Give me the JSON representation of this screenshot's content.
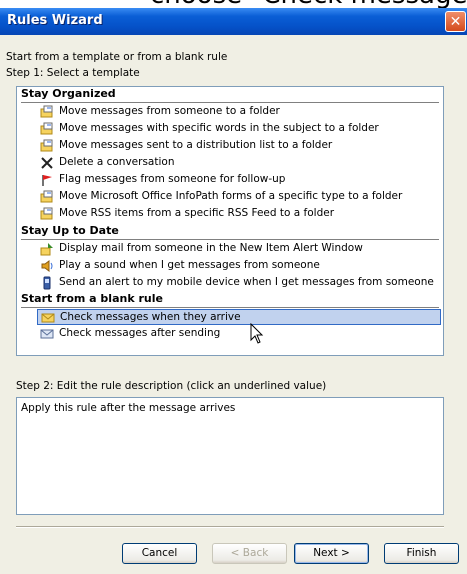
{
  "background_overlay": {
    "text": "choose \"Check messages when"
  },
  "window": {
    "title": "Rules Wizard"
  },
  "intro": {
    "line1": "Start from a template or from a blank rule",
    "line2": "Step 1: Select a template"
  },
  "groups": {
    "stay_organized": {
      "header": "Stay Organized",
      "items": [
        {
          "label": "Move messages from someone to a folder",
          "icon": "move-to-folder-icon"
        },
        {
          "label": "Move messages with specific words in the subject to a folder",
          "icon": "move-to-folder-icon"
        },
        {
          "label": "Move messages sent to a distribution list to a folder",
          "icon": "move-to-folder-icon"
        },
        {
          "label": "Delete a conversation",
          "icon": "delete-x-icon"
        },
        {
          "label": "Flag messages from someone for follow-up",
          "icon": "red-flag-icon"
        },
        {
          "label": "Move Microsoft Office InfoPath forms of a specific type to a folder",
          "icon": "move-to-folder-icon"
        },
        {
          "label": "Move RSS items from a specific RSS Feed to a folder",
          "icon": "move-to-folder-icon"
        }
      ]
    },
    "stay_up_to_date": {
      "header": "Stay Up to Date",
      "items": [
        {
          "label": "Display mail from someone in the New Item Alert Window",
          "icon": "alert-window-icon"
        },
        {
          "label": "Play a sound when I get messages from someone",
          "icon": "sound-icon"
        },
        {
          "label": "Send an alert to my mobile device when I get messages from someone",
          "icon": "mobile-device-icon"
        }
      ]
    },
    "blank_rule": {
      "header": "Start from a blank rule",
      "items": [
        {
          "label": "Check messages when they arrive",
          "icon": "envelope-icon",
          "selected": true
        },
        {
          "label": "Check messages after sending",
          "icon": "sent-mail-icon"
        }
      ]
    }
  },
  "step2": {
    "label": "Step 2: Edit the rule description (click an underlined value)",
    "description": "Apply this rule after the message arrives"
  },
  "buttons": {
    "cancel": "Cancel",
    "back": "< Back",
    "next": "Next >",
    "finish": "Finish"
  },
  "colors": {
    "titlebar": "#0551c8",
    "selection": "#c1d2ee",
    "selection_border": "#316ac5",
    "dialog_bg": "#f0efe4"
  }
}
